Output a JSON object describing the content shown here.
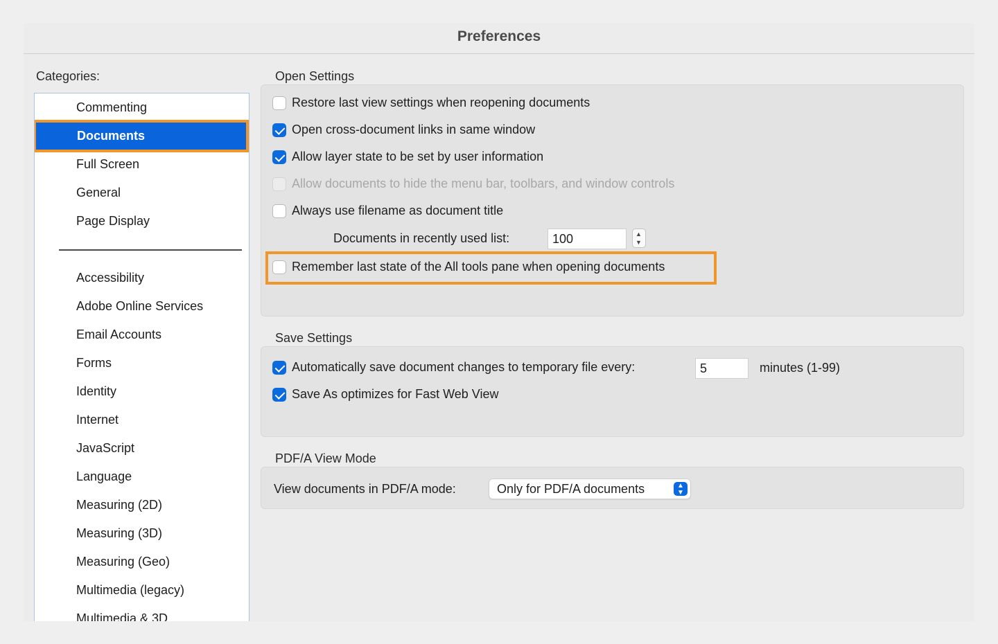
{
  "window": {
    "title": "Preferences"
  },
  "categories": {
    "label": "Categories:",
    "items": [
      {
        "label": "Commenting"
      },
      {
        "label": "Documents",
        "selected": true
      },
      {
        "label": "Full Screen"
      },
      {
        "label": "General"
      },
      {
        "label": "Page Display"
      }
    ],
    "more_items": [
      {
        "label": "Accessibility"
      },
      {
        "label": "Adobe Online Services"
      },
      {
        "label": "Email Accounts"
      },
      {
        "label": "Forms"
      },
      {
        "label": "Identity"
      },
      {
        "label": "Internet"
      },
      {
        "label": "JavaScript"
      },
      {
        "label": "Language"
      },
      {
        "label": "Measuring (2D)"
      },
      {
        "label": "Measuring (3D)"
      },
      {
        "label": "Measuring (Geo)"
      },
      {
        "label": "Multimedia (legacy)"
      },
      {
        "label": "Multimedia & 3D"
      }
    ]
  },
  "open_settings": {
    "title": "Open Settings",
    "options": [
      {
        "label": "Restore last view settings when reopening documents",
        "checked": false
      },
      {
        "label": "Open cross-document links in same window",
        "checked": true
      },
      {
        "label": "Allow layer state to be set by user information",
        "checked": true
      },
      {
        "label": "Allow documents to hide the menu bar, toolbars, and window controls",
        "checked": false,
        "disabled": true
      },
      {
        "label": "Always use filename as document title",
        "checked": false
      }
    ],
    "recent_list_label": "Documents in recently used list:",
    "recent_list_value": "100",
    "remember_tools_label": "Remember last state of the All tools pane when opening documents"
  },
  "save_settings": {
    "title": "Save Settings",
    "autosave_label": "Automatically save document changes to temporary file every:",
    "autosave_value": "5",
    "autosave_unit": "minutes (1-99)",
    "fast_web_label": "Save As optimizes for Fast Web View"
  },
  "pdfa": {
    "title": "PDF/A View Mode",
    "label": "View documents in PDF/A mode:",
    "selected": "Only for PDF/A documents"
  },
  "colors": {
    "accent": "#0b6bde",
    "highlight": "#f0962a",
    "selection": "#0a64dc"
  }
}
